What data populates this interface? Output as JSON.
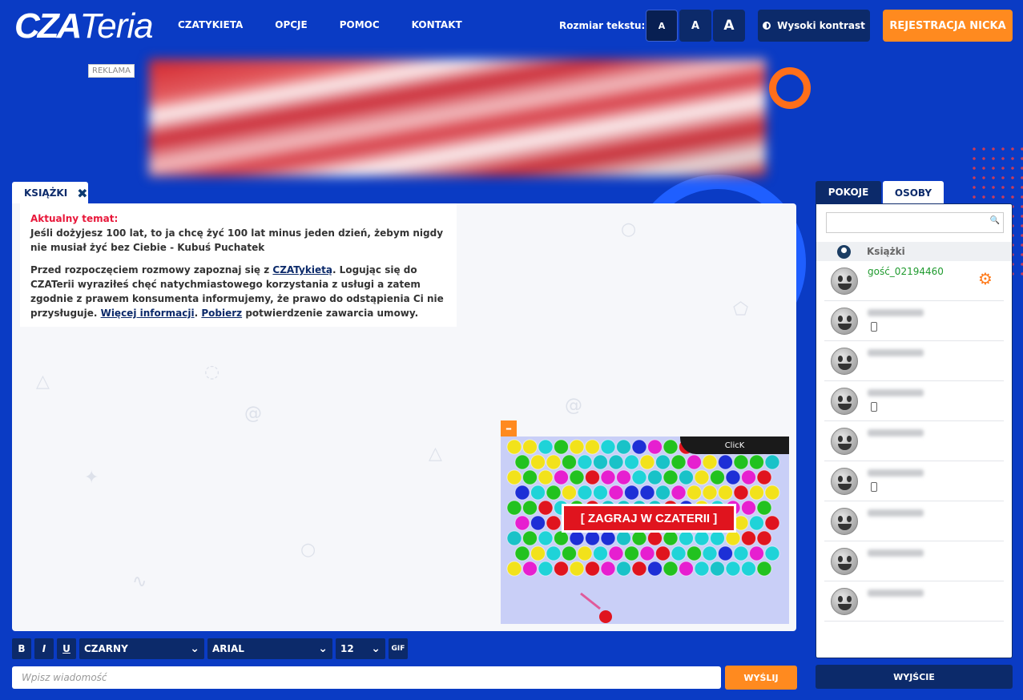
{
  "header": {
    "logo": {
      "bold": "CZA",
      "thin": "Teria"
    },
    "nav": [
      "CZATYKIETA",
      "OPCJE",
      "POMOC",
      "KONTAKT"
    ],
    "text_size_label": "Rozmiar tekstu:",
    "text_size_buttons": [
      "A",
      "A",
      "A"
    ],
    "contrast_label": "Wysoki kontrast",
    "register_label": "REJESTRACJA NICKA"
  },
  "ad": {
    "label": "REKLAMA"
  },
  "room_tab": {
    "label": "KSIĄŻKI",
    "close": "✖"
  },
  "chat": {
    "topic_title": "Aktualny temat:",
    "topic_text": "Jeśli dożyjesz 100 lat, to ja chcę żyć 100 lat minus jeden dzień, żebym nigdy nie musiał żyć bez Ciebie - Kubuś Puchatek",
    "notice_1": "Przed rozpoczęciem rozmowy zapoznaj się z ",
    "notice_link_1": "CZATykietą",
    "notice_2": ". Logując się do CZATerii wyraziłeś chęć natychmiastowego korzystania z usługi a zatem zgodnie z prawem konsumenta informujemy, że prawo do odstąpienia Ci nie przysługuje. ",
    "notice_link_2": "Więcej informacji",
    "notice_3": ". ",
    "notice_link_3": "Pobierz",
    "notice_4": " potwierdzenie zawarcia umowy."
  },
  "game_ad": {
    "minimize": "–",
    "click": "ClicK",
    "title": "[ ZAGRAJ W CZATERII ]"
  },
  "toolbar": {
    "bold": "B",
    "italic": "I",
    "underline": "U",
    "color": "CZARNY",
    "font": "ARIAL",
    "size": "12",
    "gif": "GIF",
    "chevron": "⌄"
  },
  "message": {
    "placeholder": "Wpisz wiadomość",
    "send": "WYŚLIJ"
  },
  "side": {
    "tab_rooms": "POKOJE",
    "tab_people": "OSOBY",
    "search_icon": "🔍",
    "room_name": "Książki",
    "users": [
      {
        "name": "gość_02194460",
        "mobile": false,
        "me": true
      },
      {
        "name": "",
        "mobile": true,
        "me": false
      },
      {
        "name": "",
        "mobile": false,
        "me": false
      },
      {
        "name": "",
        "mobile": true,
        "me": false
      },
      {
        "name": "",
        "mobile": false,
        "me": false
      },
      {
        "name": "",
        "mobile": true,
        "me": false
      },
      {
        "name": "",
        "mobile": false,
        "me": false
      },
      {
        "name": "",
        "mobile": false,
        "me": false
      },
      {
        "name": "",
        "mobile": false,
        "me": false
      }
    ],
    "gear_icon": "⚙",
    "exit": "WYJŚCIE"
  },
  "colors": {
    "background": "#0a3bc4",
    "accent": "#ff8a1f",
    "navy": "#0c2a6a",
    "alert": "#e8173a",
    "online": "#1f9a2e"
  }
}
